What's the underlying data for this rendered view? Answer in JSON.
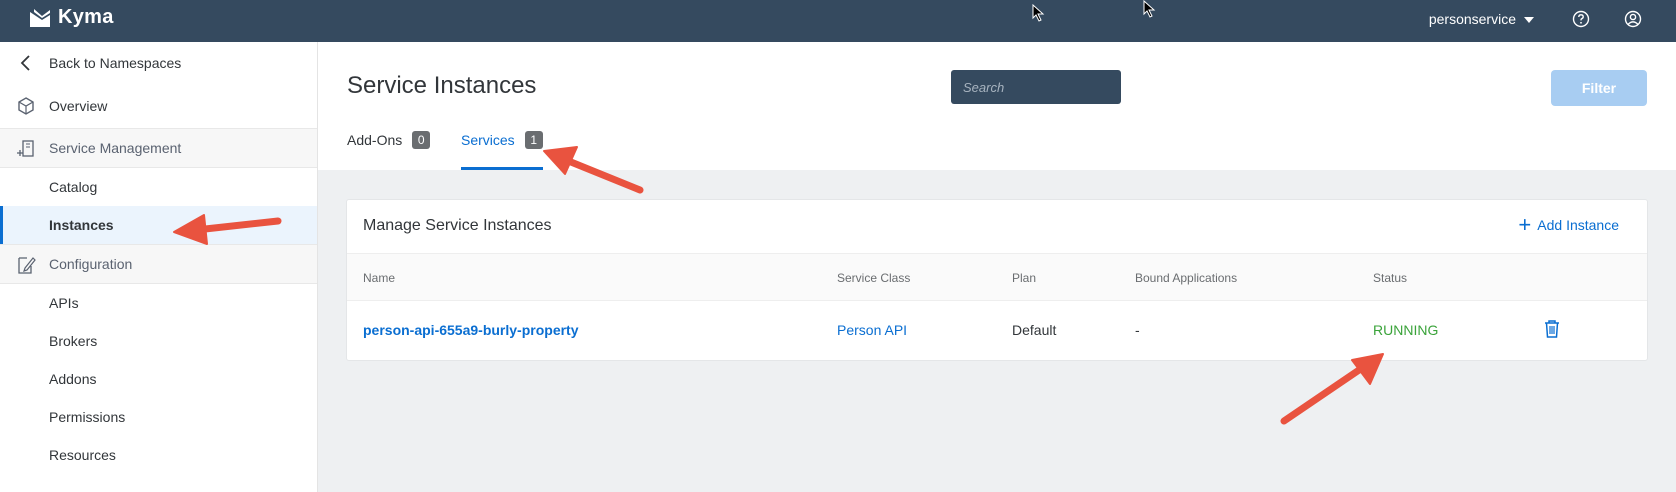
{
  "app": {
    "name": "Kyma"
  },
  "topbar": {
    "user": "personservice"
  },
  "sidebar": {
    "back": "Back to Namespaces",
    "overview": "Overview",
    "sections": [
      {
        "label": "Service Management",
        "items": [
          "Catalog",
          "Instances"
        ]
      },
      {
        "label": "Configuration",
        "items": [
          "APIs",
          "Brokers",
          "Addons",
          "Permissions",
          "Resources"
        ]
      }
    ],
    "active_item": "Instances"
  },
  "header": {
    "title": "Service Instances",
    "search_placeholder": "Search",
    "filter_label": "Filter",
    "tabs": [
      {
        "label": "Add-Ons",
        "count": "0",
        "active": false
      },
      {
        "label": "Services",
        "count": "1",
        "active": true
      }
    ]
  },
  "panel": {
    "title": "Manage Service Instances",
    "add_label": "Add Instance",
    "columns": [
      "Name",
      "Service Class",
      "Plan",
      "Bound Applications",
      "Status"
    ],
    "rows": [
      {
        "name": "person-api-655a9-burly-property",
        "service_class": "Person API",
        "plan": "Default",
        "bound_applications": "-",
        "status": "RUNNING"
      }
    ]
  },
  "colors": {
    "topbar": "#354a5f",
    "accent": "#0a6ed1",
    "status_running": "#3aa33a",
    "annotation_arrow": "#e9533f"
  }
}
